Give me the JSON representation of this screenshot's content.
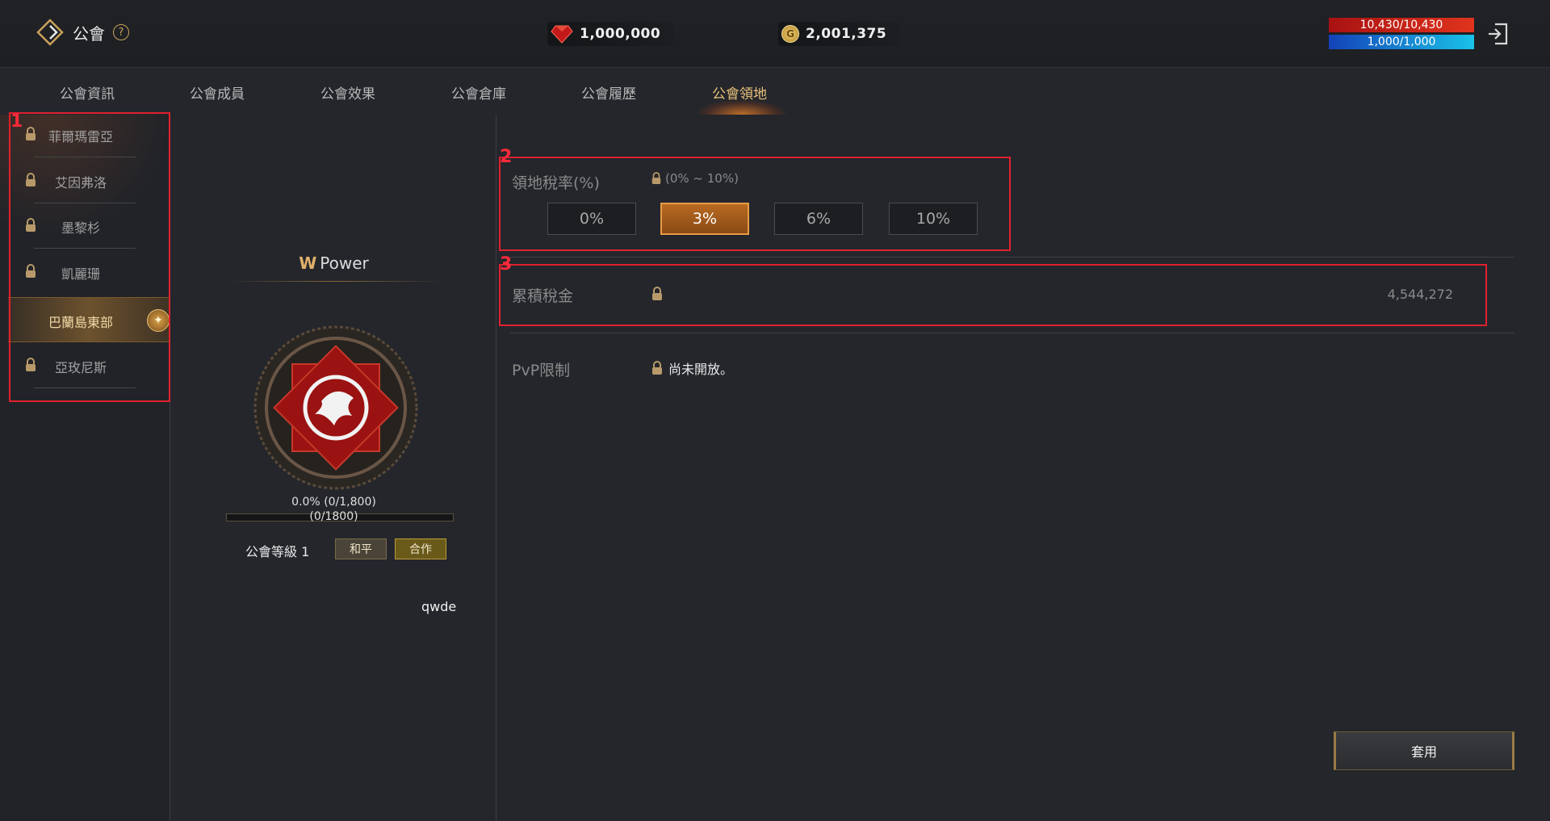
{
  "header": {
    "title": "公會",
    "help": "?",
    "currencies": [
      {
        "icon": "red-gem-icon",
        "value": "1,000,000"
      },
      {
        "icon": "gold-coin-icon",
        "value": "2,001,375"
      }
    ],
    "hp": "10,430/10,430",
    "mp": "1,000/1,000",
    "colors": {
      "accent": "#e8c07a",
      "hp": "#c8231a",
      "mp": "#1a8fd8"
    }
  },
  "tabs": [
    {
      "label": "公會資訊"
    },
    {
      "label": "公會成員"
    },
    {
      "label": "公會效果"
    },
    {
      "label": "公會倉庫"
    },
    {
      "label": "公會履歷"
    },
    {
      "label": "公會領地"
    }
  ],
  "regions": [
    {
      "name": "菲爾瑪雷亞",
      "locked": true
    },
    {
      "name": "艾因弗洛",
      "locked": true
    },
    {
      "name": "墨黎杉",
      "locked": true
    },
    {
      "name": "凱麗珊",
      "locked": true
    },
    {
      "name": "巴蘭島東部",
      "locked": false
    },
    {
      "name": "亞玫尼斯",
      "locked": true
    }
  ],
  "annotations": [
    "1",
    "2",
    "3"
  ],
  "guild": {
    "title_prefix": "W",
    "title": "Power",
    "progress_text": "0.0% (0/1,800)",
    "progress_sub": "(0/1800)",
    "progress_fraction": 0.0,
    "level": "公會等級 1",
    "stance_peace": "和平",
    "stance_coop": "合作",
    "leader": "qwde"
  },
  "territory": {
    "tax_rate_label": "領地稅率(%)",
    "tax_range": "(0% ~ 10%)",
    "rates": [
      "0%",
      "3%",
      "6%",
      "10%"
    ],
    "selected_rate": "3%",
    "accum_tax_label": "累積稅金",
    "accum_tax_value": "4,544,272",
    "pvp_label": "PvP限制",
    "pvp_value": "尚未開放。"
  },
  "apply_label": "套用"
}
